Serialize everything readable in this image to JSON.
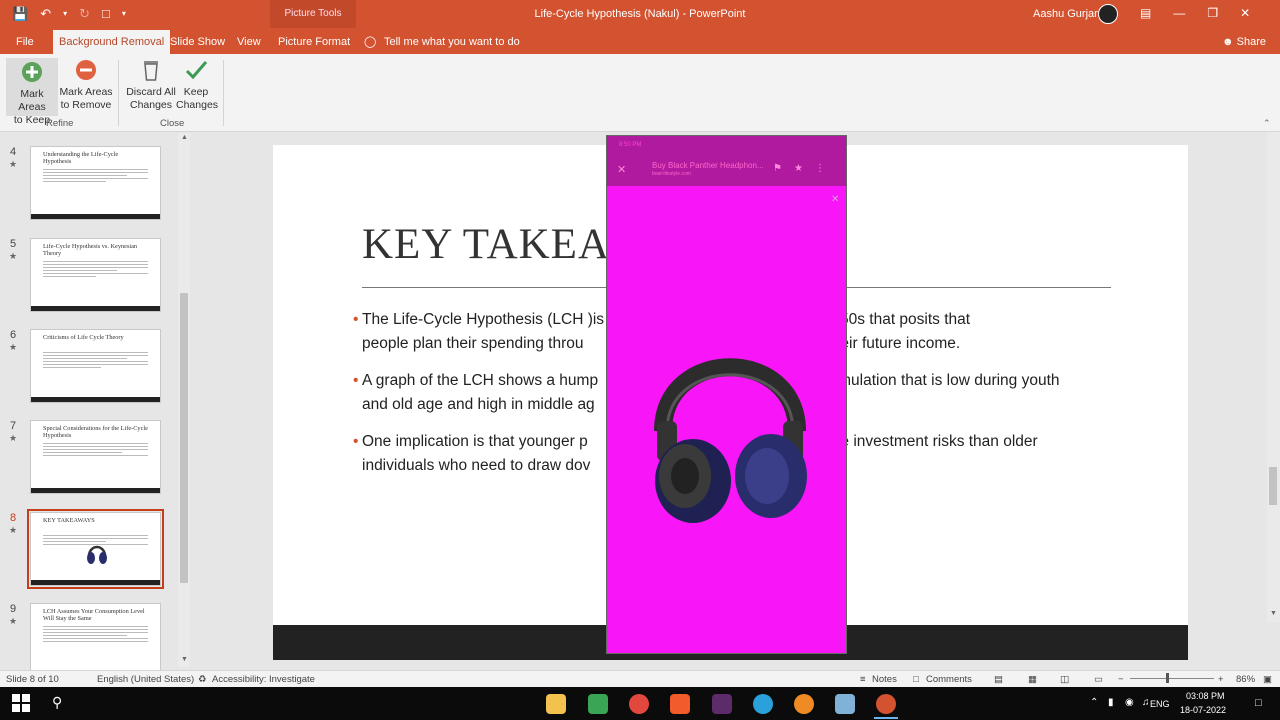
{
  "window": {
    "context_tab": "Picture Tools",
    "title": "Life-Cycle Hypothesis (Nakul)  -  PowerPoint",
    "user": "Aashu Gurjar"
  },
  "tabs": [
    {
      "label": "File"
    },
    {
      "label": "Background Removal"
    },
    {
      "label": "Slide Show"
    },
    {
      "label": "View"
    },
    {
      "label": "Picture Format"
    },
    {
      "label": "Tell me what you want to do"
    }
  ],
  "share": "Share",
  "ribbon": {
    "mark_keep_1": "Mark Areas",
    "mark_keep_2": "to Keep",
    "mark_remove_1": "Mark Areas",
    "mark_remove_2": "to Remove",
    "discard_1": "Discard All",
    "discard_2": "Changes",
    "keep_1": "Keep",
    "keep_2": "Changes",
    "group_refine": "Refine",
    "group_close": "Close"
  },
  "thumbnails": [
    {
      "num": "4",
      "title": "Understanding the Life-Cycle Hypothesis"
    },
    {
      "num": "5",
      "title": "Life-Cycle Hypothesis vs. Keynesian Theory"
    },
    {
      "num": "6",
      "title": "Criticisms of Life Cycle Theory"
    },
    {
      "num": "7",
      "title": "Special Considerations for the Life-Cycle Hypothesis"
    },
    {
      "num": "8",
      "title": "KEY TAKEAWAYS"
    },
    {
      "num": "9",
      "title": "LCH Assumes Your Consumption Level Will Stay the Same"
    }
  ],
  "slide": {
    "title": "KEY TAKEA",
    "bullets": [
      {
        "a": "The Life-Cycle Hypothesis (LCH )is",
        "b": "n the early 1950s that posits that",
        "c": "people plan their spending throu",
        "d": "their future income."
      },
      {
        "a": "A graph of the LCH shows a hump",
        "b": "mulation that is low during youth",
        "c": "and old age and high in middle ag",
        "d": ""
      },
      {
        "a": "One implication is that younger p",
        "b": "take investment risks than older",
        "c": "individuals who need to draw dov",
        "d": ""
      }
    ]
  },
  "picture": {
    "status": "8:50 PM",
    "url": "Buy Black Panther Headphon...",
    "domain": "boat-lifestyle.com"
  },
  "status": {
    "slide": "Slide 8 of 10",
    "language": "English (United States)",
    "accessibility": "Accessibility: Investigate",
    "notes": "Notes",
    "comments": "Comments",
    "zoom": "86%"
  },
  "taskbar": {
    "lang": "ENG",
    "time": "03:08 PM",
    "date": "18-07-2022"
  }
}
